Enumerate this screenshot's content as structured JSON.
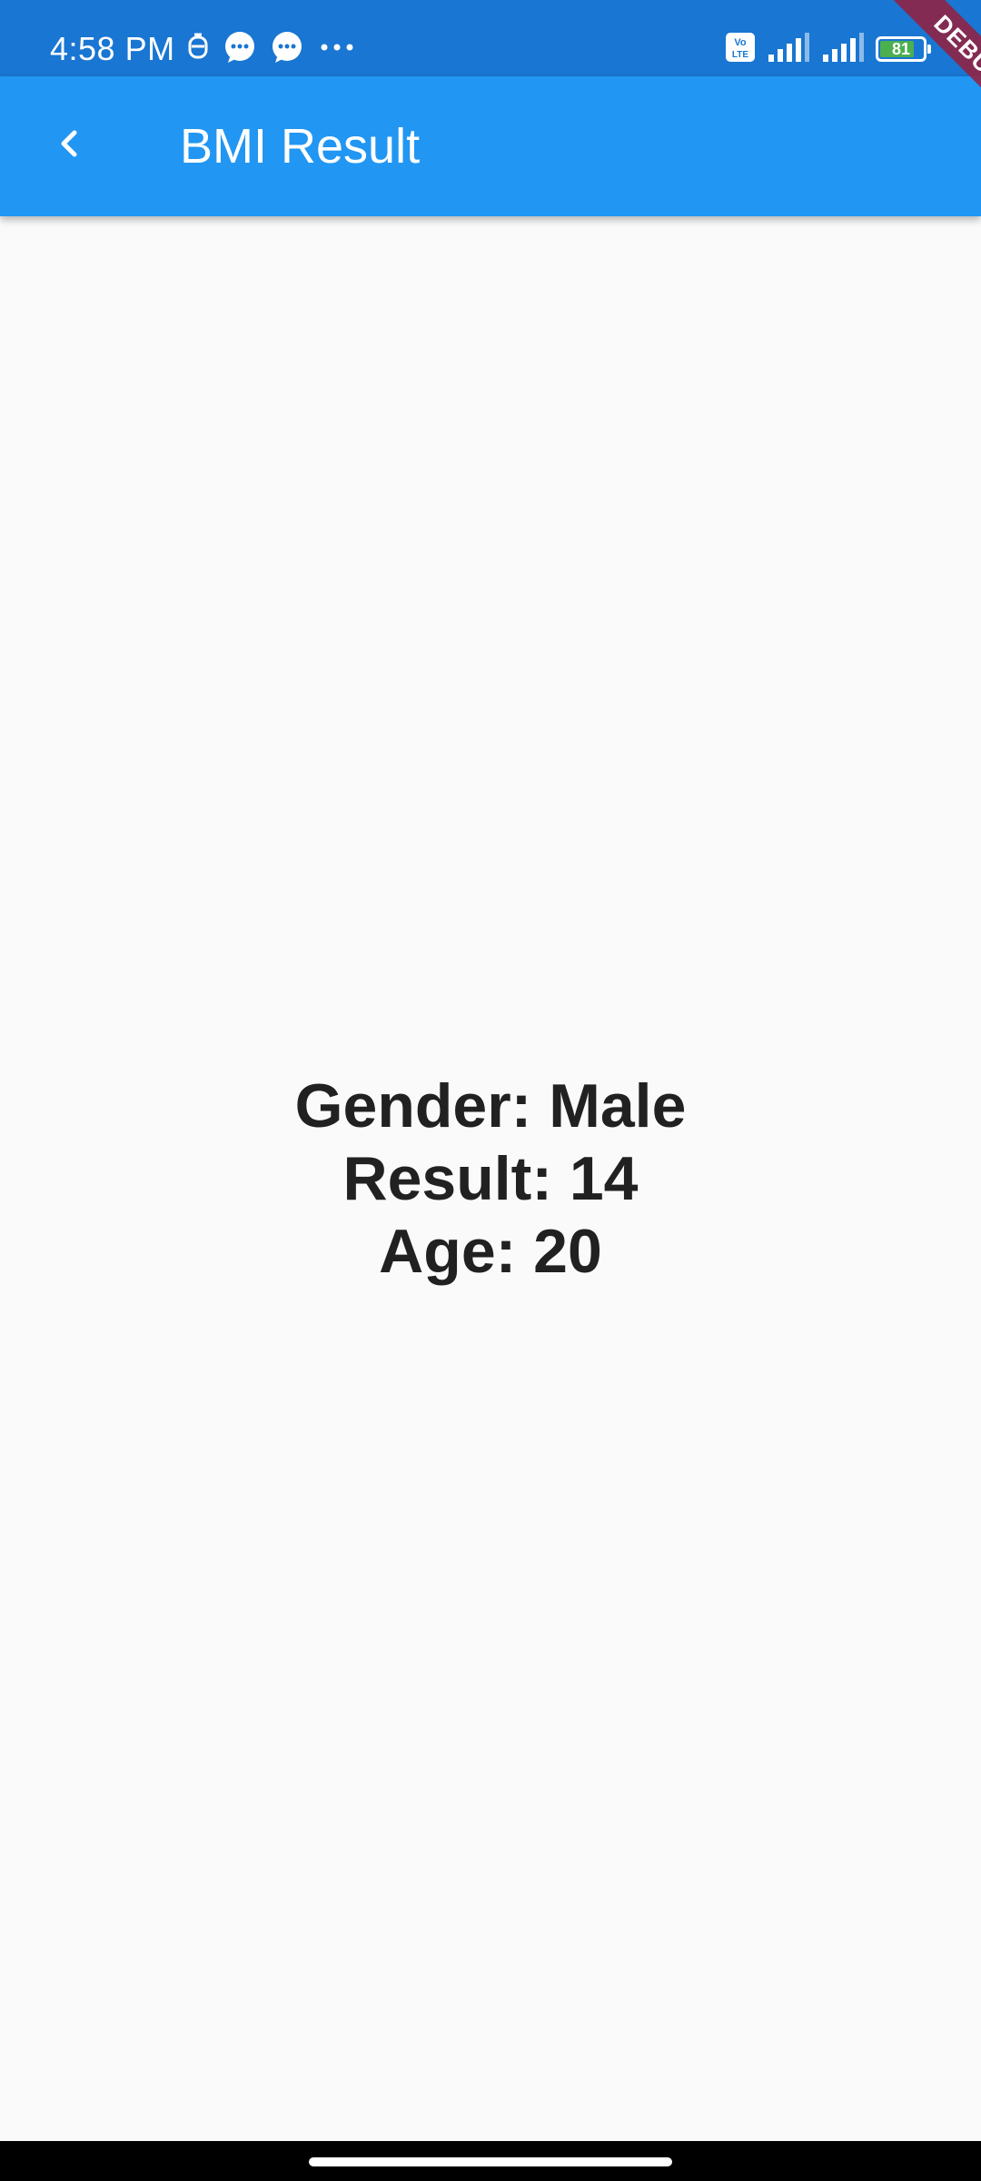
{
  "status_bar": {
    "time": "4:58 PM",
    "battery_level": "81",
    "battery_fraction": 0.81,
    "left_icons": [
      "emergency-icon",
      "chat-bubble-icon",
      "chat-bubble-icon",
      "more-dots-icon"
    ],
    "right_icons": [
      "volte-icon",
      "signal-icon",
      "signal-icon",
      "battery-icon"
    ]
  },
  "app_bar": {
    "title": "BMI Result",
    "back_icon": "chevron-left-icon",
    "color": "#2196f3"
  },
  "debug_banner": {
    "label": "DEBUG"
  },
  "result": {
    "gender_line": "Gender: Male",
    "result_line": "Result: 14",
    "age_line": "Age: 20"
  },
  "colors": {
    "status_bar": "#1976d2",
    "app_bar": "#2196f3",
    "background": "#fafafa",
    "text": "#212121"
  }
}
